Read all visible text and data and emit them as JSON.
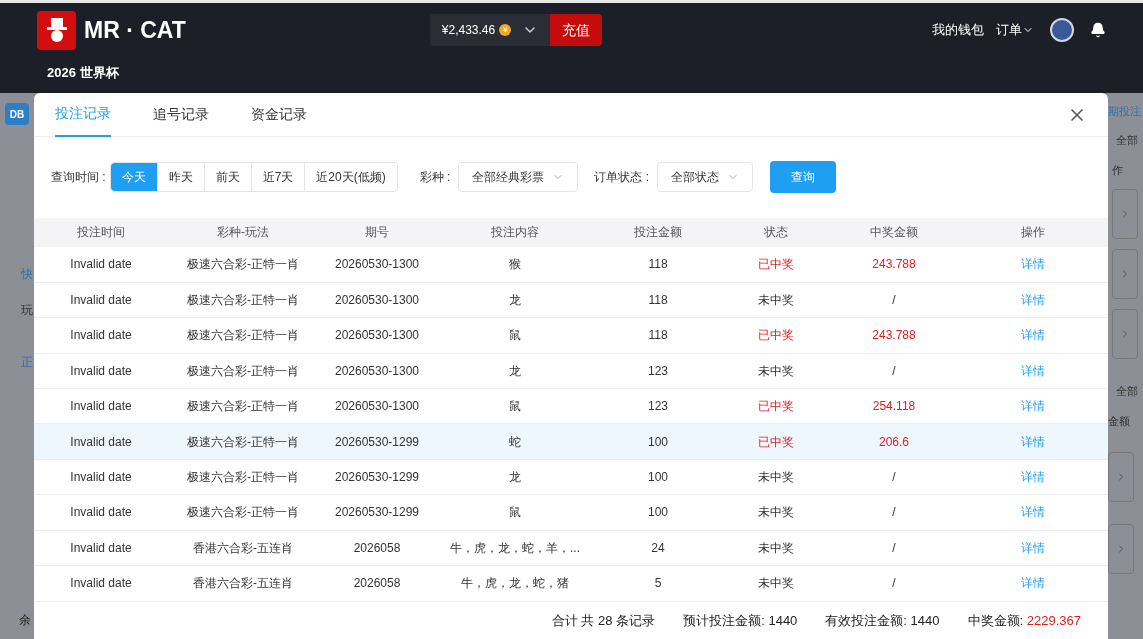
{
  "header": {
    "brand": "MR · CAT",
    "balance": "¥2,433.46",
    "coin": "¥",
    "recharge": "充值",
    "wallet": "我的钱包",
    "orders": "订单",
    "nav": "2026 世界杯"
  },
  "background": {
    "badge": "DB",
    "left": [
      "快",
      "玩",
      "正",
      "余"
    ],
    "right_top": "期投注",
    "right": [
      "全部",
      "作",
      "全部",
      "金额"
    ]
  },
  "tabs": [
    {
      "label": "投注记录",
      "selected": true
    },
    {
      "label": "追号记录",
      "selected": false
    },
    {
      "label": "资金记录",
      "selected": false
    }
  ],
  "filters": {
    "time_label": "查询时间 :",
    "ranges": [
      {
        "label": "今天",
        "selected": true
      },
      {
        "label": "昨天",
        "selected": false
      },
      {
        "label": "前天",
        "selected": false
      },
      {
        "label": "近7天",
        "selected": false
      },
      {
        "label": "近20天(低频)",
        "selected": false
      }
    ],
    "lottery_label": "彩种 :",
    "lottery": "全部经典彩票",
    "status_label": "订单状态 :",
    "status": "全部状态",
    "search": "查询"
  },
  "table": {
    "columns": [
      "投注时间",
      "彩种-玩法",
      "期号",
      "投注内容",
      "投注金额",
      "状态",
      "中奖金额",
      "操作"
    ],
    "rows": [
      {
        "time": "Invalid date",
        "game": "极速六合彩-正特一肖",
        "issue": "20260530-1300",
        "content": "猴",
        "amount": "118",
        "status": "已中奖",
        "won": true,
        "prize": "243.788",
        "action": "详情",
        "selected": false
      },
      {
        "time": "Invalid date",
        "game": "极速六合彩-正特一肖",
        "issue": "20260530-1300",
        "content": "龙",
        "amount": "118",
        "status": "未中奖",
        "won": false,
        "prize": "/",
        "action": "详情",
        "selected": false
      },
      {
        "time": "Invalid date",
        "game": "极速六合彩-正特一肖",
        "issue": "20260530-1300",
        "content": "鼠",
        "amount": "118",
        "status": "已中奖",
        "won": true,
        "prize": "243.788",
        "action": "详情",
        "selected": false
      },
      {
        "time": "Invalid date",
        "game": "极速六合彩-正特一肖",
        "issue": "20260530-1300",
        "content": "龙",
        "amount": "123",
        "status": "未中奖",
        "won": false,
        "prize": "/",
        "action": "详情",
        "selected": false
      },
      {
        "time": "Invalid date",
        "game": "极速六合彩-正特一肖",
        "issue": "20260530-1300",
        "content": "鼠",
        "amount": "123",
        "status": "已中奖",
        "won": true,
        "prize": "254.118",
        "action": "详情",
        "selected": false
      },
      {
        "time": "Invalid date",
        "game": "极速六合彩-正特一肖",
        "issue": "20260530-1299",
        "content": "蛇",
        "amount": "100",
        "status": "已中奖",
        "won": true,
        "prize": "206.6",
        "action": "详情",
        "selected": true
      },
      {
        "time": "Invalid date",
        "game": "极速六合彩-正特一肖",
        "issue": "20260530-1299",
        "content": "龙",
        "amount": "100",
        "status": "未中奖",
        "won": false,
        "prize": "/",
        "action": "详情",
        "selected": false
      },
      {
        "time": "Invalid date",
        "game": "极速六合彩-正特一肖",
        "issue": "20260530-1299",
        "content": "鼠",
        "amount": "100",
        "status": "未中奖",
        "won": false,
        "prize": "/",
        "action": "详情",
        "selected": false
      },
      {
        "time": "Invalid date",
        "game": "香港六合彩-五连肖",
        "issue": "2026058",
        "content": "牛，虎，龙，蛇，羊，...",
        "amount": "24",
        "status": "未中奖",
        "won": false,
        "prize": "/",
        "action": "详情",
        "selected": false
      },
      {
        "time": "Invalid date",
        "game": "香港六合彩-五连肖",
        "issue": "2026058",
        "content": "牛，虎，龙，蛇，猪",
        "amount": "5",
        "status": "未中奖",
        "won": false,
        "prize": "/",
        "action": "详情",
        "selected": false
      }
    ]
  },
  "summary": {
    "count": "合计 共 28 条记录",
    "expected_label": "预计投注金额:",
    "expected": "1440",
    "valid_label": "有效投注金额:",
    "valid": "1440",
    "prize_label": "中奖金额:",
    "prize": "2229.367"
  }
}
